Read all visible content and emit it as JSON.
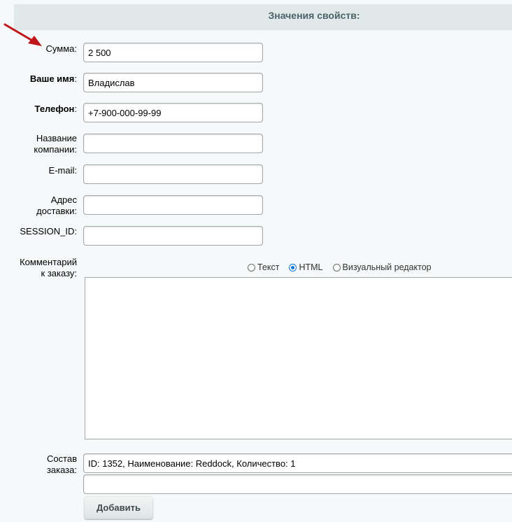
{
  "header": {
    "title": "Значения свойств:"
  },
  "fields": {
    "summa": {
      "label": "Сумма:",
      "value": "2 500"
    },
    "name": {
      "label": "Ваше имя",
      "colon": ":",
      "value": "Владислав"
    },
    "phone": {
      "label": "Телефон",
      "colon": ":",
      "value": "+7-900-000-99-99"
    },
    "company": {
      "label_line1": "Название",
      "label_line2": "компании:",
      "value": ""
    },
    "email": {
      "label": "E-mail:",
      "value": ""
    },
    "address": {
      "label_line1": "Адрес",
      "label_line2": "доставки:",
      "value": ""
    },
    "session": {
      "label": "SESSION_ID:",
      "value": ""
    },
    "comment": {
      "label_line1": "Комментарий",
      "label_line2": "к заказу:"
    },
    "order": {
      "label_line1": "Состав",
      "label_line2": "заказа:",
      "value1": "ID: 1352, Наименование: Reddock, Количество: 1",
      "value2": ""
    }
  },
  "editor_modes": [
    {
      "label": "Текст",
      "checked": false
    },
    {
      "label": "HTML",
      "checked": true
    },
    {
      "label": "Визуальный редактор",
      "checked": false
    }
  ],
  "buttons": {
    "add_label": "Добавить"
  },
  "colors": {
    "accent_arrow": "#c0171c",
    "radio_checked": "#0b73d8",
    "header_bg": "#e0e8ea"
  },
  "icons": {
    "annotation": "red-arrow-icon"
  }
}
